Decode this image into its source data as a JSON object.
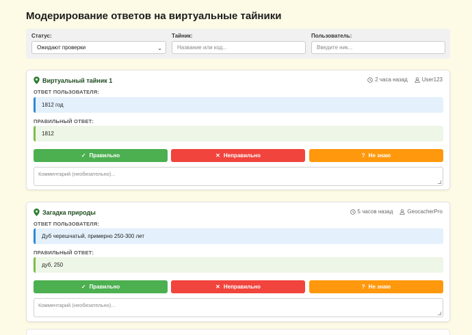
{
  "page": {
    "title": "Модерирование ответов на виртуальные тайники"
  },
  "filters": {
    "status_label": "Статус:",
    "status_value": "Ожидают проверки",
    "cache_label": "Тайник:",
    "cache_placeholder": "Название или код...",
    "user_label": "Пользователь:",
    "user_placeholder": "Введите ник..."
  },
  "cards": [
    {
      "title": "Виртуальный тайник 1",
      "time": "2 часа назад",
      "user": "User123",
      "user_answer_label": "ОТВЕТ ПОЛЬЗОВАТЕЛЯ:",
      "user_answer": "1812 год",
      "correct_answer_label": "ПРАВИЛЬНЫЙ ОТВЕТ:",
      "correct_answer": "1812",
      "btn_correct": "Правильно",
      "btn_wrong": "Неправильно",
      "btn_unknown": "Не знаю",
      "comment_placeholder": "Комментарий (необязательно)..."
    },
    {
      "title": "Загадка природы",
      "time": "5 часов назад",
      "user": "GeocacherPro",
      "user_answer_label": "ОТВЕТ ПОЛЬЗОВАТЕЛЯ:",
      "user_answer": "Дуб черешчатый, примерно 250-300 лет",
      "correct_answer_label": "ПРАВИЛЬНЫЙ ОТВЕТ:",
      "correct_answer": "дуб, 250",
      "btn_correct": "Правильно",
      "btn_wrong": "Неправильно",
      "btn_unknown": "Не знаю",
      "comment_placeholder": "Комментарий (необязательно)..."
    }
  ],
  "icons": {
    "title_icon": "map-pin-icon",
    "time_icon": "clock-icon",
    "user_icon": "user-icon",
    "correct_icon": "check-icon",
    "wrong_icon": "x-icon",
    "unknown_icon": "question-icon"
  },
  "colors": {
    "background": "#fdfae6",
    "correct": "#4caf50",
    "wrong": "#f0443d",
    "unknown": "#ff980c",
    "user_answer_accent": "#2e88d4",
    "correct_answer_accent": "#7cbc4a"
  }
}
